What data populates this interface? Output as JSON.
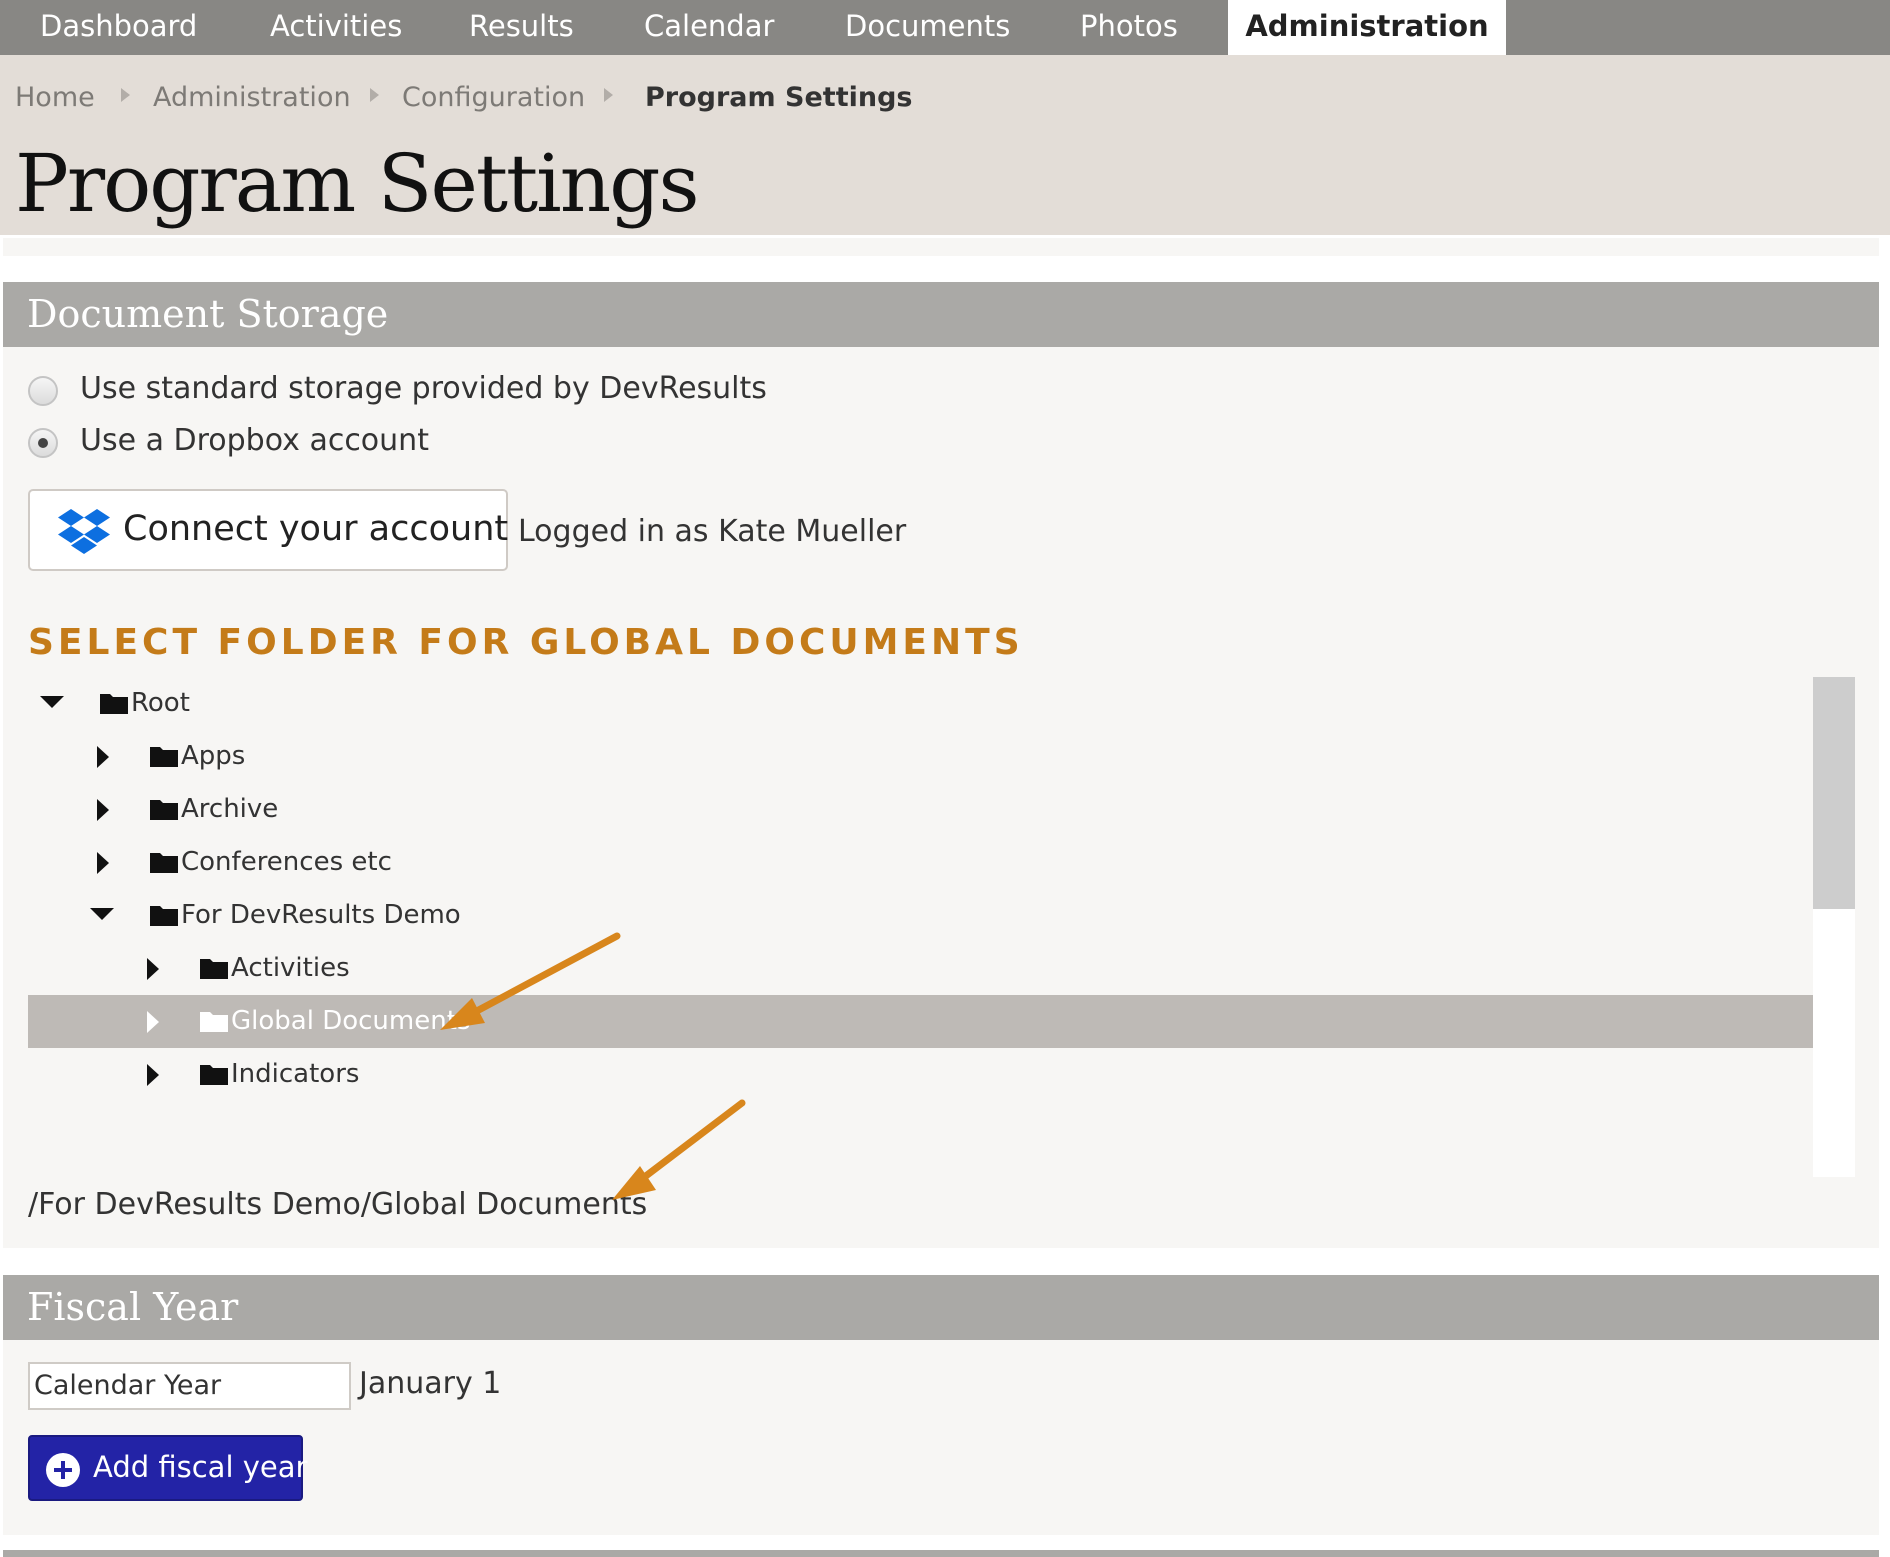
{
  "nav": {
    "tabs": [
      "Dashboard",
      "Activities",
      "Results",
      "Calendar",
      "Documents",
      "Photos",
      "Administration"
    ],
    "active": "Administration"
  },
  "breadcrumb": [
    "Home",
    "Administration",
    "Configuration",
    "Program Settings"
  ],
  "page_title": "Program Settings",
  "document_storage": {
    "heading": "Document Storage",
    "options": [
      "Use standard storage provided by DevResults",
      "Use a Dropbox account"
    ],
    "selected_option": "Use a Dropbox account",
    "connect_button": "Connect your account",
    "logged_in": "Logged in as Kate Mueller",
    "folder_section_label": "SELECT FOLDER FOR GLOBAL DOCUMENTS",
    "tree": [
      {
        "label": "Root",
        "expanded": true
      },
      {
        "label": "Apps",
        "expanded": false
      },
      {
        "label": "Archive",
        "expanded": false
      },
      {
        "label": "Conferences etc",
        "expanded": false
      },
      {
        "label": "For DevResults Demo",
        "expanded": true
      },
      {
        "label": "Activities",
        "expanded": false
      },
      {
        "label": "Global Documents",
        "expanded": false,
        "selected": true
      },
      {
        "label": "Indicators",
        "expanded": false
      }
    ],
    "selected_path": "/For DevResults Demo/Global Documents"
  },
  "fiscal_year": {
    "heading": "Fiscal Year",
    "input_value": "Calendar Year",
    "start_date": "January 1",
    "add_button": "Add fiscal year"
  },
  "colors": {
    "nav_bg": "#888784",
    "header_bg": "#e3ddd7",
    "panel_head_bg": "#aaa9a6",
    "section_label": "#c47b19",
    "selected_row": "#bebab6",
    "add_button": "#2323a6",
    "annotation_arrow": "#d8861c",
    "dropbox_blue": "#0d6fe0"
  },
  "icons": [
    "dropbox-icon",
    "folder-icon",
    "caret-down-icon",
    "caret-right-icon",
    "plus-circle-icon",
    "breadcrumb-separator-icon"
  ]
}
